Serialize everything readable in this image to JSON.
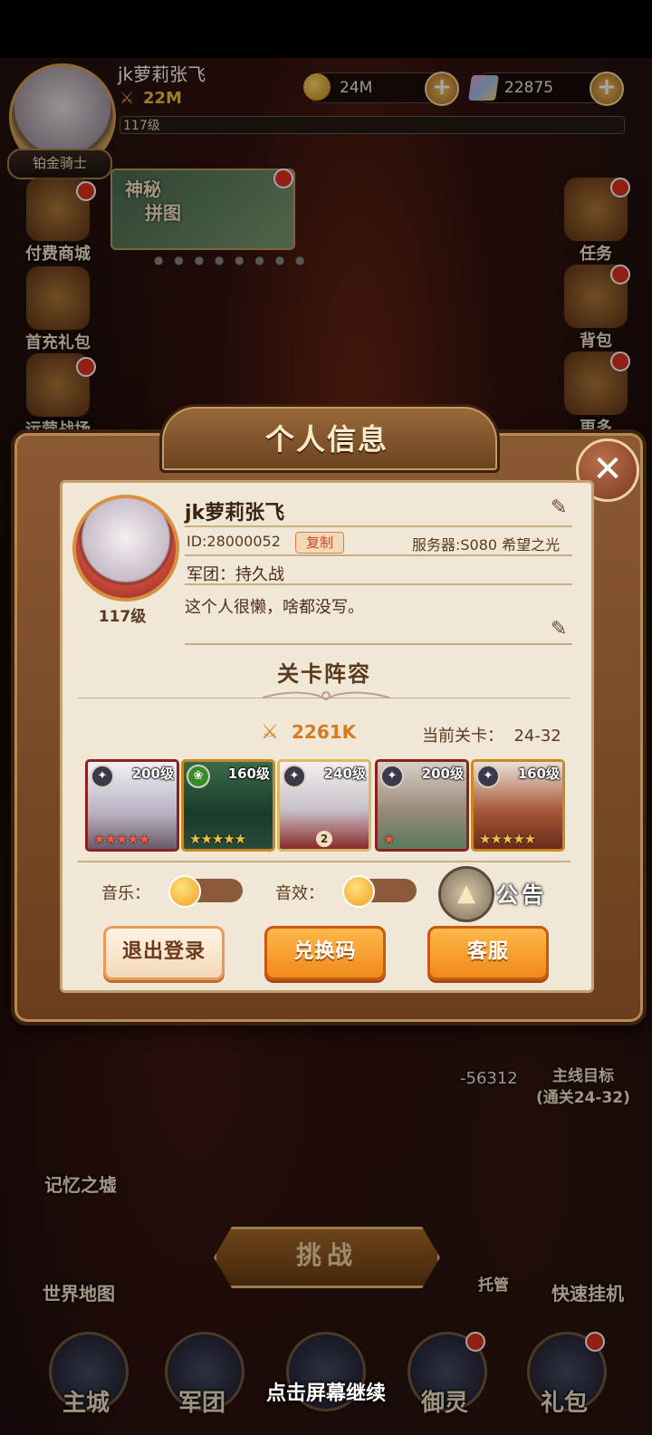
{
  "hud": {
    "player_name": "jk萝莉张飞",
    "power": "22M",
    "level": "117级",
    "rank": "铂金骑士",
    "gold": "24M",
    "gems": "22875"
  },
  "left_menu": [
    "付费商城",
    "首充礼包",
    "运营战场"
  ],
  "right_menu": [
    "任务",
    "背包",
    "更多"
  ],
  "puzzle": {
    "label_line1": "神秘",
    "label_line2": "拼图"
  },
  "dialog": {
    "title": "个人信息",
    "name": "jk萝莉张飞",
    "level": "117级",
    "id": "ID:28000052",
    "copy_label": "复制",
    "server": "服务器:S080 希望之光",
    "guild": "军团：持久战",
    "signature": "这个人很懒，啥都没写。",
    "lineup_title": "关卡阵容",
    "power": "2261K",
    "stage_label": "当前关卡：",
    "stage_value": "24-32",
    "heroes": [
      {
        "level": "200级",
        "stars": "★★★★★",
        "faction": "✦"
      },
      {
        "level": "160级",
        "stars": "★★★★★",
        "faction": "❀"
      },
      {
        "level": "240级",
        "stars": "",
        "faction": "✦",
        "badge": "2"
      },
      {
        "level": "200级",
        "stars": "★",
        "faction": "✦"
      },
      {
        "level": "160级",
        "stars": "★★★★★",
        "faction": "✦"
      }
    ],
    "music_label": "音乐：",
    "sfx_label": "音效：",
    "notice_label": "公告",
    "buttons": {
      "logout": "退出登录",
      "redeem": "兑换码",
      "support": "客服"
    }
  },
  "scene": {
    "damage": "-56312",
    "quest_line1": "主线目标",
    "quest_line2": "(通关24-32)",
    "memory": "记忆之墟",
    "world_map": "世界地图",
    "hosting": "托管",
    "quick_idle": "快速挂机",
    "challenge": "挑战"
  },
  "nav": [
    "主城",
    "军团",
    "",
    "御灵",
    "礼包"
  ],
  "continue_hint": "点击屏幕继续"
}
